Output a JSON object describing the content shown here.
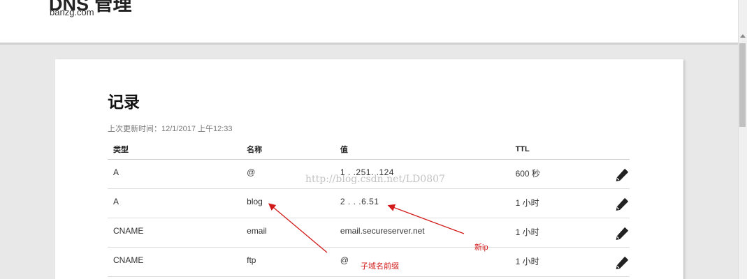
{
  "header": {
    "title": "DNS 管理",
    "domain": "banzg.com"
  },
  "records_section": {
    "title": "记录",
    "last_updated": "上次更新时间：12/1/2017 上午12:33",
    "columns": {
      "type": "类型",
      "name": "名称",
      "value": "值",
      "ttl": "TTL"
    },
    "rows": [
      {
        "type": "A",
        "name": "@",
        "value": "1 . .251.  .124",
        "ttl": "600 秒"
      },
      {
        "type": "A",
        "name": "blog",
        "value": "2  . .  .6.51",
        "ttl": "1 小时"
      },
      {
        "type": "CNAME",
        "name": "email",
        "value": "email.secureserver.net",
        "ttl": "1 小时"
      },
      {
        "type": "CNAME",
        "name": "ftp",
        "value": "@",
        "ttl": "1 小时"
      }
    ]
  },
  "watermark": "http://blog.csdn.net/LD0807",
  "annotations": {
    "new_ip": "新ip",
    "subdomain_prefix": "子域名前缀"
  },
  "colors": {
    "annotation": "#d21a1a",
    "page_bg": "#e8e8e8",
    "card_bg": "#ffffff"
  },
  "icons": {
    "edit": "pencil-icon"
  }
}
